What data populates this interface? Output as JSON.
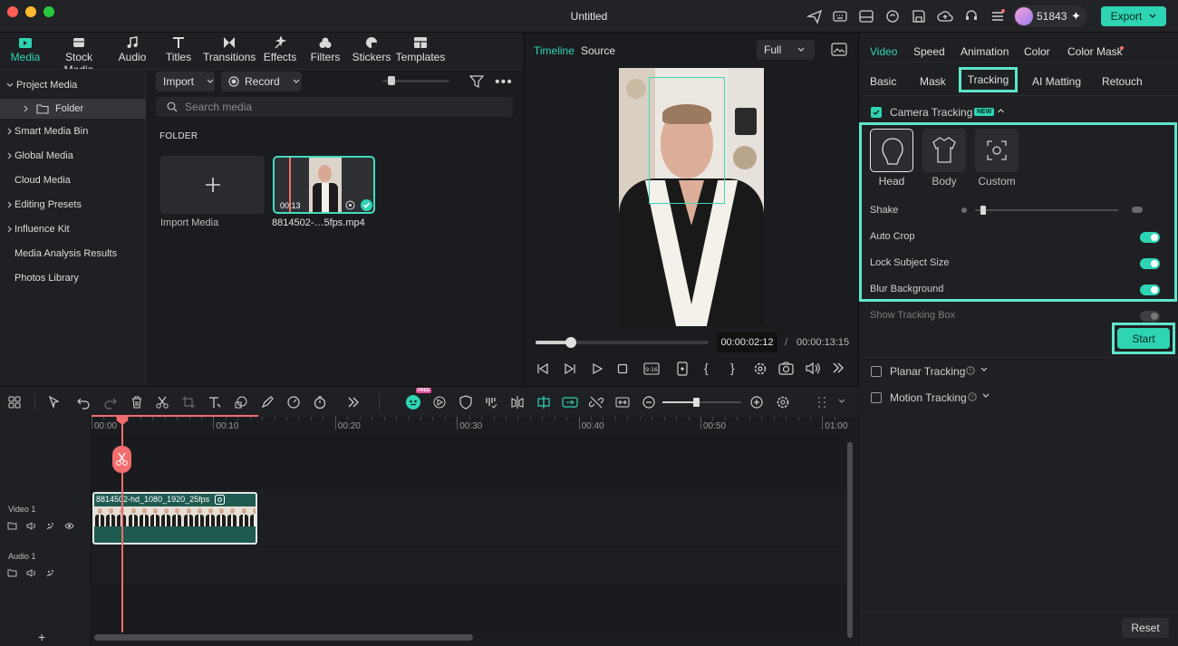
{
  "window": {
    "title": "Untitled"
  },
  "user": {
    "count": "51843"
  },
  "export_label": "Export",
  "media_tabs": [
    {
      "label": "Media",
      "icon": "media-icon",
      "active": true
    },
    {
      "label": "Stock Media",
      "icon": "stock-media-icon"
    },
    {
      "label": "Audio",
      "icon": "audio-icon"
    },
    {
      "label": "Titles",
      "icon": "titles-icon"
    },
    {
      "label": "Transitions",
      "icon": "transitions-icon"
    },
    {
      "label": "Effects",
      "icon": "effects-icon"
    },
    {
      "label": "Filters",
      "icon": "filters-icon"
    },
    {
      "label": "Stickers",
      "icon": "stickers-icon"
    },
    {
      "label": "Templates",
      "icon": "templates-icon"
    }
  ],
  "library": [
    {
      "label": "Project Media",
      "expanded": true
    },
    {
      "label": "Folder",
      "child": true,
      "selected": true
    },
    {
      "label": "Smart Media Bin"
    },
    {
      "label": "Global Media"
    },
    {
      "label": "Cloud Media"
    },
    {
      "label": "Editing Presets"
    },
    {
      "label": "Influence Kit"
    },
    {
      "label": "Media Analysis Results"
    },
    {
      "label": "Photos Library"
    }
  ],
  "media_toolbar": {
    "import": "Import",
    "record": "Record",
    "search_placeholder": "Search media",
    "folder_heading": "FOLDER"
  },
  "media_items": {
    "import_label": "Import Media",
    "clip_name": "8814502-…5fps.mp4",
    "clip_duration": "00:13"
  },
  "preview": {
    "tab_timeline": "Timeline",
    "tab_source": "Source",
    "quality": "Full",
    "current_time": "00:00:02:12",
    "separator": "/",
    "total_time": "00:00:13:15"
  },
  "props": {
    "tabs": [
      "Video",
      "Speed",
      "Animation",
      "Color",
      "Color Mask"
    ],
    "subtabs": [
      "Basic",
      "Mask",
      "Tracking",
      "AI Matting",
      "Retouch"
    ],
    "camera_tracking": "Camera Tracking",
    "new_badge": "NEW",
    "targets": [
      "Head",
      "Body",
      "Custom"
    ],
    "shake": "Shake",
    "auto_crop": "Auto Crop",
    "lock_subject": "Lock Subject Size",
    "blur_bg": "Blur Background",
    "show_box": "Show Tracking Box",
    "start": "Start",
    "planar": "Planar Tracking",
    "motion": "Motion Tracking",
    "reset": "Reset"
  },
  "timeline": {
    "ruler": [
      "00:00",
      "00:10",
      "00:20",
      "00:30",
      "00:40",
      "00:50",
      "01:00"
    ],
    "video_track": "Video 1",
    "audio_track": "Audio 1",
    "clip_title": "8814502-hd_1080_1920_25fps",
    "ai_badge": "FREE"
  },
  "colors": {
    "accent": "#2fd4b4",
    "playhead": "#f26d6d",
    "highlight": "#5ee6cb"
  }
}
